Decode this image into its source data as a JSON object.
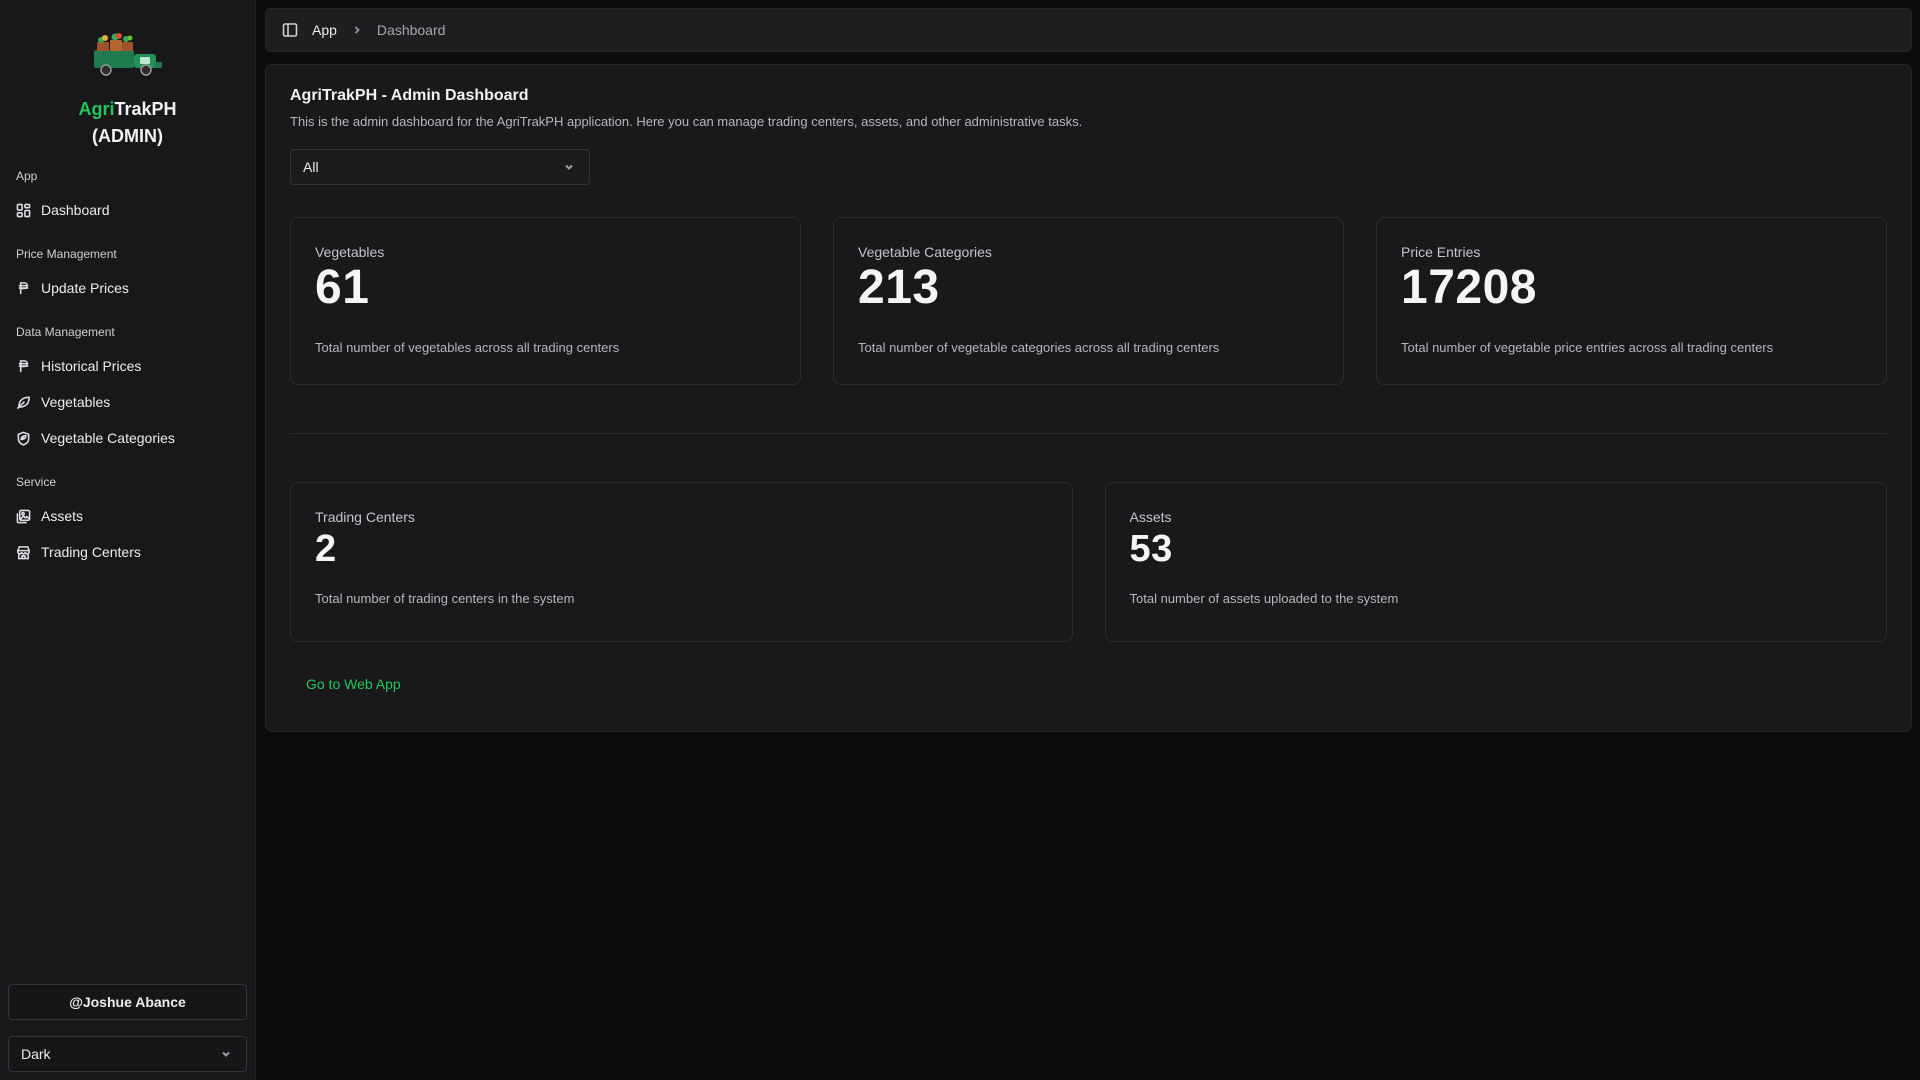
{
  "sidebar": {
    "brand_accent": "Agri",
    "brand_rest": "TrakPH",
    "brand_sub": "(ADMIN)",
    "groups": [
      {
        "label": "App",
        "items": [
          {
            "label": "Dashboard",
            "icon": "dashboard-icon"
          }
        ]
      },
      {
        "label": "Price Management",
        "items": [
          {
            "label": "Update Prices",
            "icon": "peso-icon"
          }
        ]
      },
      {
        "label": "Data Management",
        "items": [
          {
            "label": "Historical Prices",
            "icon": "peso-icon"
          },
          {
            "label": "Vegetables",
            "icon": "leaf-icon"
          },
          {
            "label": "Vegetable Categories",
            "icon": "shield-leaf-icon"
          }
        ]
      },
      {
        "label": "Service",
        "items": [
          {
            "label": "Assets",
            "icon": "image-gallery-icon"
          },
          {
            "label": "Trading Centers",
            "icon": "store-icon"
          }
        ]
      }
    ],
    "user_label": "@Joshue Abance",
    "theme_value": "Dark"
  },
  "topbar": {
    "crumb_app": "App",
    "crumb_current": "Dashboard"
  },
  "main": {
    "title": "AgriTrakPH - Admin Dashboard",
    "description": "This is the admin dashboard for the AgriTrakPH application. Here you can manage trading centers, assets, and other administrative tasks.",
    "filter_value": "All",
    "stats_top": [
      {
        "label": "Vegetables",
        "value": "61",
        "desc": "Total number of vegetables across all trading centers"
      },
      {
        "label": "Vegetable Categories",
        "value": "213",
        "desc": "Total number of vegetable categories across all trading centers"
      },
      {
        "label": "Price Entries",
        "value": "17208",
        "desc": "Total number of vegetable price entries across all trading centers"
      }
    ],
    "stats_bottom": [
      {
        "label": "Trading Centers",
        "value": "2",
        "desc": "Total number of trading centers in the system"
      },
      {
        "label": "Assets",
        "value": "53",
        "desc": "Total number of assets uploaded to the system"
      }
    ],
    "web_link": "Go to Web App"
  },
  "colors": {
    "accent": "#22c55e",
    "background": "#0c0c0d",
    "sidebar": "#18181a",
    "card": "#19191b"
  }
}
